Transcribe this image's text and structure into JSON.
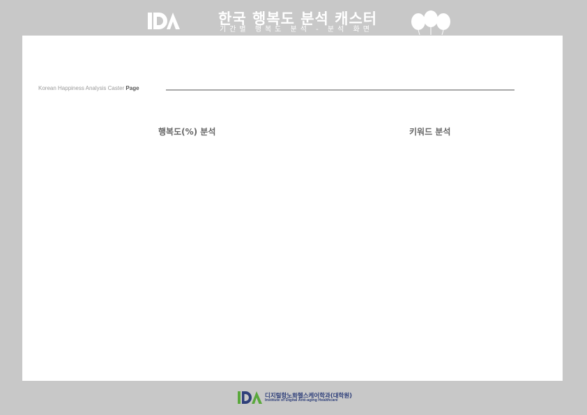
{
  "header": {
    "title": "한국 행복도 분석 캐스터",
    "subtitle": "기간별 행복도 분석 - 분석 화면"
  },
  "page_label": {
    "prefix": "Korean Happiness Analysis Caster",
    "suffix": "Page"
  },
  "sections": {
    "happiness": "행복도(%) 분석",
    "keyword": "키워드 분석"
  },
  "footer": {
    "org_kr": "디지털항노화헬스케어학과(대학원)",
    "org_en": "Institute of Digital Anti-aging Healthcare"
  },
  "colors": {
    "background": "#c8c8c8",
    "panel": "#ffffff",
    "footer_green": "#5aa83c",
    "footer_blue": "#2e3f7a"
  },
  "icons": {
    "header_logo": "ida-logo",
    "balloons": "balloons-icon",
    "footer_logo": "ida-logo-color"
  }
}
